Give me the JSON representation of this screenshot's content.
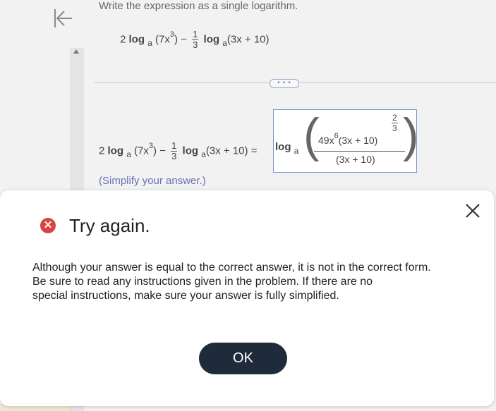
{
  "prompt": "Write the expression as a single logarithm.",
  "expression": {
    "coef": "2",
    "log": "log",
    "base": "a",
    "arg1_open": "(7x",
    "arg1_exp": "3",
    "arg1_close": ")",
    "minus": "−",
    "frac_num": "1",
    "frac_den": "3",
    "arg2": "(3x + 10)"
  },
  "equals": "=",
  "answer": {
    "log": "log",
    "base": "a",
    "numerator_main": "49x",
    "numerator_exp": "6",
    "numerator_rest": "(3x + 10)",
    "inner_exp_num": "2",
    "inner_exp_den": "3",
    "denominator": "(3x + 10)"
  },
  "ellipsis": "• • •",
  "simplify_hint": "(Simplify your answer.)",
  "dialog": {
    "title": "Try again.",
    "error_icon_glyph": "✕",
    "message_lines": [
      "Although your answer is equal to the correct answer, it is not in the correct form.",
      "Be sure to read any instructions given in the problem. If there are no",
      "special instructions, make sure your answer is fully simplified."
    ],
    "ok_label": "OK",
    "close_glyph": "✕"
  },
  "colors": {
    "error_red": "#d64541",
    "ok_button": "#1f2a3a",
    "hint_text": "#6a6fb5",
    "answer_border": "#7b93cf"
  }
}
